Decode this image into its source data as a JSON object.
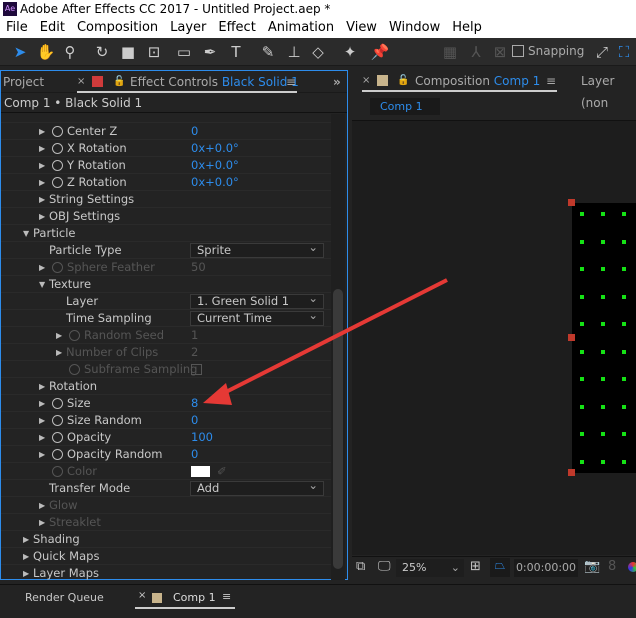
{
  "title": "Adobe After Effects CC 2017 - Untitled Project.aep *",
  "logo": "Ae",
  "menu": [
    "File",
    "Edit",
    "Composition",
    "Layer",
    "Effect",
    "Animation",
    "View",
    "Window",
    "Help"
  ],
  "toolbar": {
    "snapping": "Snapping",
    "snapping_checked": false
  },
  "left_panel": {
    "project_tab": "Project",
    "ec_tab_prefix": "Effect Controls",
    "ec_tab_layer": "Black Solid 1",
    "breadcrumb": "Comp 1 • Black Solid 1",
    "layer_color": "#d03b3b"
  },
  "effect_rows": [
    {
      "label": "Center Z",
      "indent": 2,
      "arrow": "right",
      "stopwatch": true,
      "value": "0"
    },
    {
      "label": "X Rotation",
      "indent": 2,
      "arrow": "right",
      "stopwatch": true,
      "value": "0x+0.0°"
    },
    {
      "label": "Y Rotation",
      "indent": 2,
      "arrow": "right",
      "stopwatch": true,
      "value": "0x+0.0°"
    },
    {
      "label": "Z Rotation",
      "indent": 2,
      "arrow": "right",
      "stopwatch": true,
      "value": "0x+0.0°"
    },
    {
      "label": "String Settings",
      "indent": 2,
      "arrow": "right"
    },
    {
      "label": "OBJ Settings",
      "indent": 2,
      "arrow": "right"
    },
    {
      "label": "Particle",
      "indent": 1,
      "arrow": "down"
    },
    {
      "label": "Particle Type",
      "indent": 2,
      "dropdown": "Sprite"
    },
    {
      "label": "Sphere Feather",
      "indent": 2,
      "arrow": "right",
      "stopwatch": true,
      "value": "50",
      "disabled": true
    },
    {
      "label": "Texture",
      "indent": 2,
      "arrow": "down"
    },
    {
      "label": "Layer",
      "indent": 3,
      "dropdown": "1. Green Solid 1"
    },
    {
      "label": "Time Sampling",
      "indent": 3,
      "dropdown": "Current Time"
    },
    {
      "label": "Random Seed",
      "indent": 3,
      "arrow": "right",
      "stopwatch": true,
      "value": "1",
      "disabled": true
    },
    {
      "label": "Number of Clips",
      "indent": 3,
      "arrow": "right",
      "value": "2",
      "disabled": true
    },
    {
      "label": "Subframe Sampling",
      "indent": 3,
      "stopwatch": true,
      "checkbox": true,
      "disabled": true
    },
    {
      "label": "Rotation",
      "indent": 2,
      "arrow": "right"
    },
    {
      "label": "Size",
      "indent": 2,
      "arrow": "right",
      "stopwatch": true,
      "value": "8"
    },
    {
      "label": "Size Random",
      "indent": 2,
      "arrow": "right",
      "stopwatch": true,
      "value": "0"
    },
    {
      "label": "Opacity",
      "indent": 2,
      "arrow": "right",
      "stopwatch": true,
      "value": "100"
    },
    {
      "label": "Opacity Random",
      "indent": 2,
      "arrow": "right",
      "stopwatch": true,
      "value": "0"
    },
    {
      "label": "Color",
      "indent": 2,
      "stopwatch": true,
      "swatch": "#ffffff",
      "disabled": true
    },
    {
      "label": "Transfer Mode",
      "indent": 2,
      "dropdown": "Add"
    },
    {
      "label": "Glow",
      "indent": 2,
      "arrow": "right",
      "disabled": true
    },
    {
      "label": "Streaklet",
      "indent": 2,
      "arrow": "right",
      "disabled": true
    },
    {
      "label": "Shading",
      "indent": 1,
      "arrow": "right"
    },
    {
      "label": "Quick Maps",
      "indent": 1,
      "arrow": "right"
    },
    {
      "label": "Layer Maps",
      "indent": 1,
      "arrow": "right"
    }
  ],
  "comp_panel": {
    "tab_prefix": "Composition",
    "tab_comp": "Comp 1",
    "layer_tab": "Layer (non",
    "comp_button": "Comp 1",
    "zoom": "25%",
    "timecode": "0:00:00:00",
    "comp_color": "#c8b48c"
  },
  "bottom": {
    "render_queue": "Render Queue",
    "comp_tab": "Comp 1"
  },
  "colors": {
    "accent": "#2d8ceb",
    "particle": "#15e215",
    "arrow": "#e53935"
  }
}
